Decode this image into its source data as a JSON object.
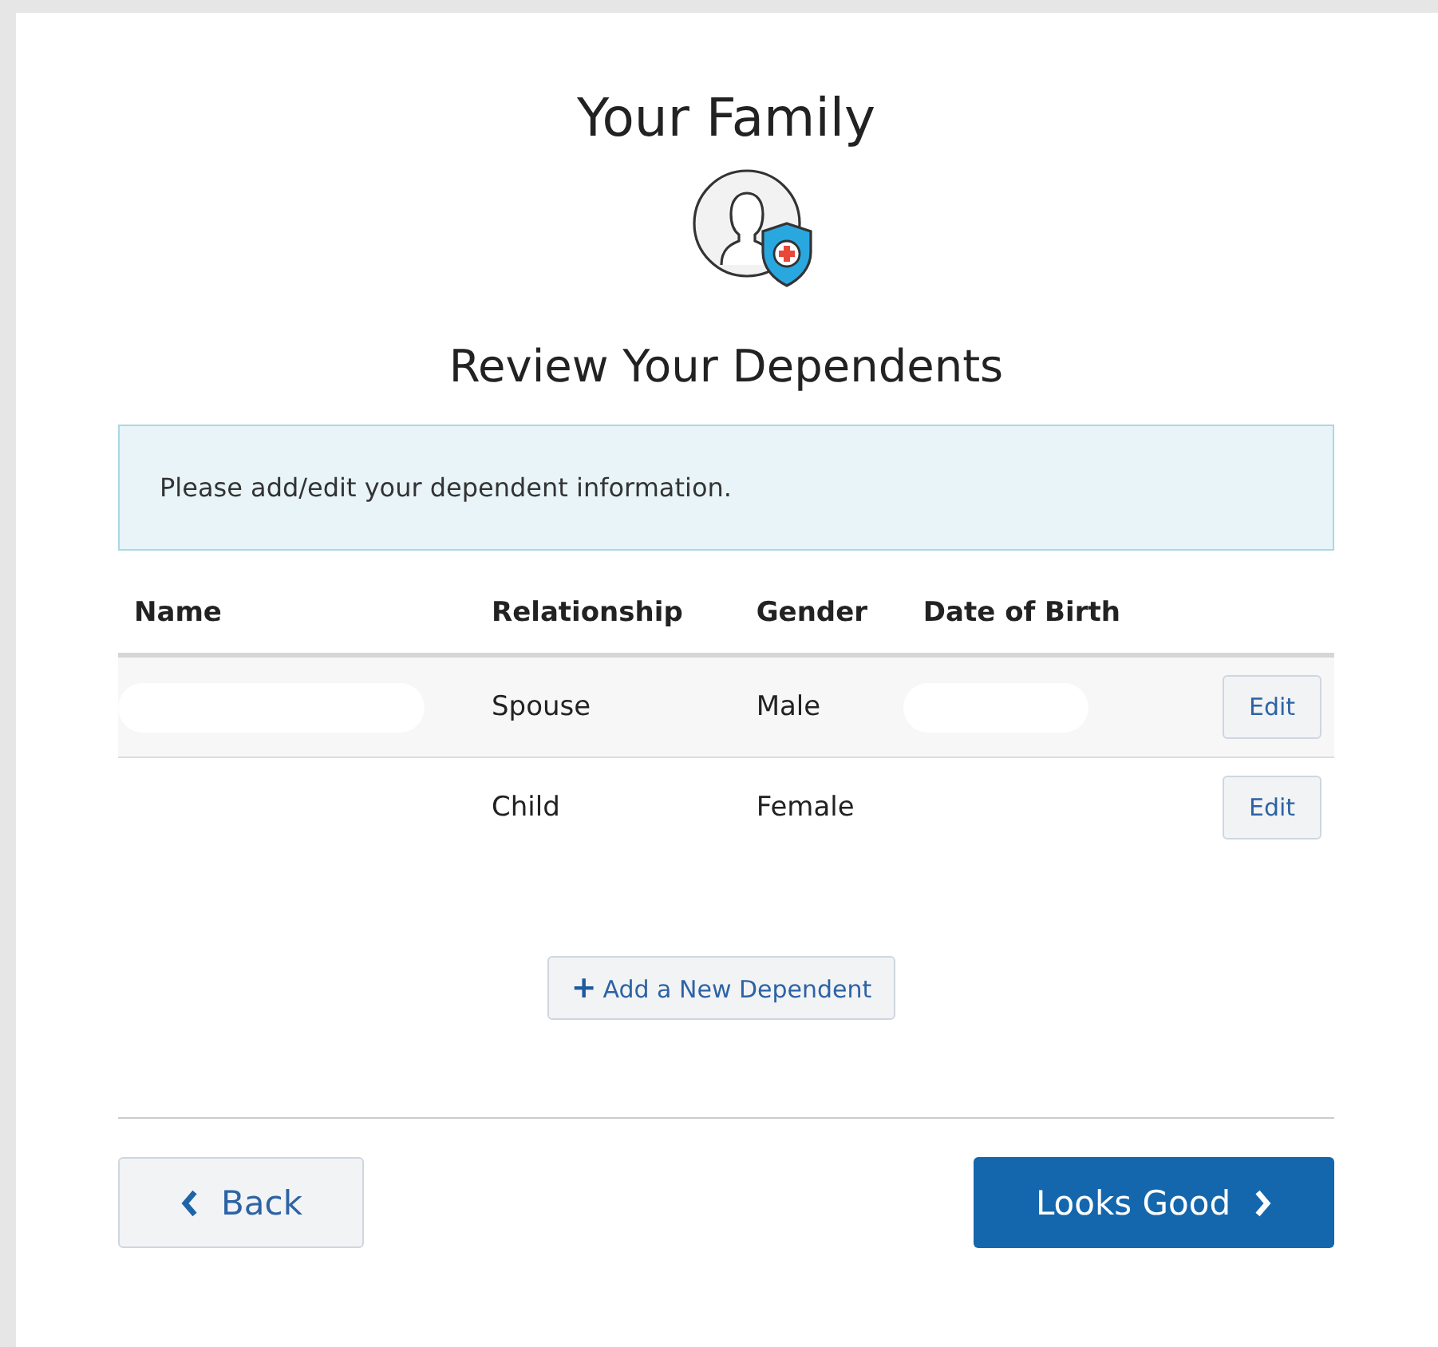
{
  "title": "Your Family",
  "subtitle": "Review Your Dependents",
  "notice": "Please add/edit your dependent information.",
  "table": {
    "columns": [
      "Name",
      "Relationship",
      "Gender",
      "Date of Birth"
    ],
    "rows": [
      {
        "relationship": "Spouse",
        "gender": "Male",
        "action": "Edit"
      },
      {
        "relationship": "Child",
        "gender": "Female",
        "action": "Edit"
      }
    ]
  },
  "add_button": {
    "icon": "+",
    "label": "Add a New Dependent"
  },
  "back_button": "Back",
  "next_button": "Looks Good"
}
